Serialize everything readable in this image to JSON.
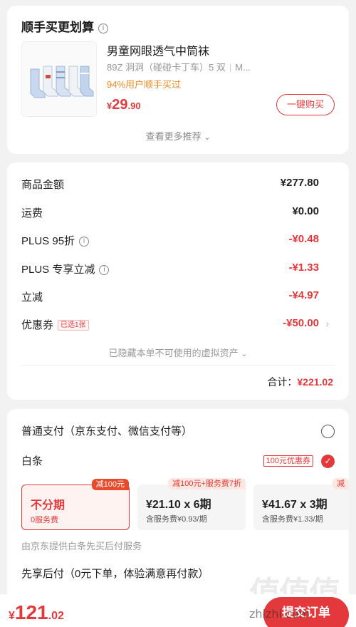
{
  "recommend": {
    "title": "顺手买更划算",
    "product": {
      "name": "男童网眼透气中筒袜",
      "spec_1": "89Z 洞洞（碰碰卡丁车）5 双",
      "spec_2": "M...",
      "bought": "94%用户顺手买过",
      "price_symbol": "¥",
      "price_int": "29",
      "price_dec": ".90"
    },
    "buy_button": "一键购买",
    "more_label": "查看更多推荐"
  },
  "costs": {
    "rows": [
      {
        "label": "商品金额",
        "value": "¥277.80"
      },
      {
        "label": "运费",
        "value": "¥0.00"
      },
      {
        "label": "PLUS 95折",
        "value": "-¥0.48"
      },
      {
        "label": "PLUS 专享立减",
        "value": "-¥1.33"
      },
      {
        "label": "立减",
        "value": "-¥4.97"
      },
      {
        "label": "优惠券",
        "value": "-¥50.00",
        "tag": "已选1张"
      }
    ],
    "hidden_note": "已隐藏本单不可使用的虚拟资产",
    "total_label": "合计：",
    "total_value": "¥221.02"
  },
  "payment": {
    "normal": "普通支付（京东支付、微信支付等）",
    "baitiao": "白条",
    "baitiao_discount": "100元优惠券",
    "plans": [
      {
        "main": "不分期",
        "sub": "0服务费",
        "badge": "减100元",
        "selected": true
      },
      {
        "main": "¥21.10 x 6期",
        "sub": "含服务费¥0.93/期",
        "badge": "减100元+服务费7折"
      },
      {
        "main": "¥41.67 x 3期",
        "sub": "含服务费¥1.33/期",
        "badge": "减"
      }
    ],
    "provider": "由京东提供白条先买后付服务",
    "after": "先享后付（0元下单，体验满意再付款）"
  },
  "bottom": {
    "price_symbol": "¥",
    "price_int": "121",
    "price_dec": ".02",
    "submit": "提交订单"
  },
  "watermark": {
    "logo": "值值值",
    "text": "zhizhi.com"
  },
  "colors": {
    "accent": "#e4393c",
    "orange": "#f08a24"
  }
}
